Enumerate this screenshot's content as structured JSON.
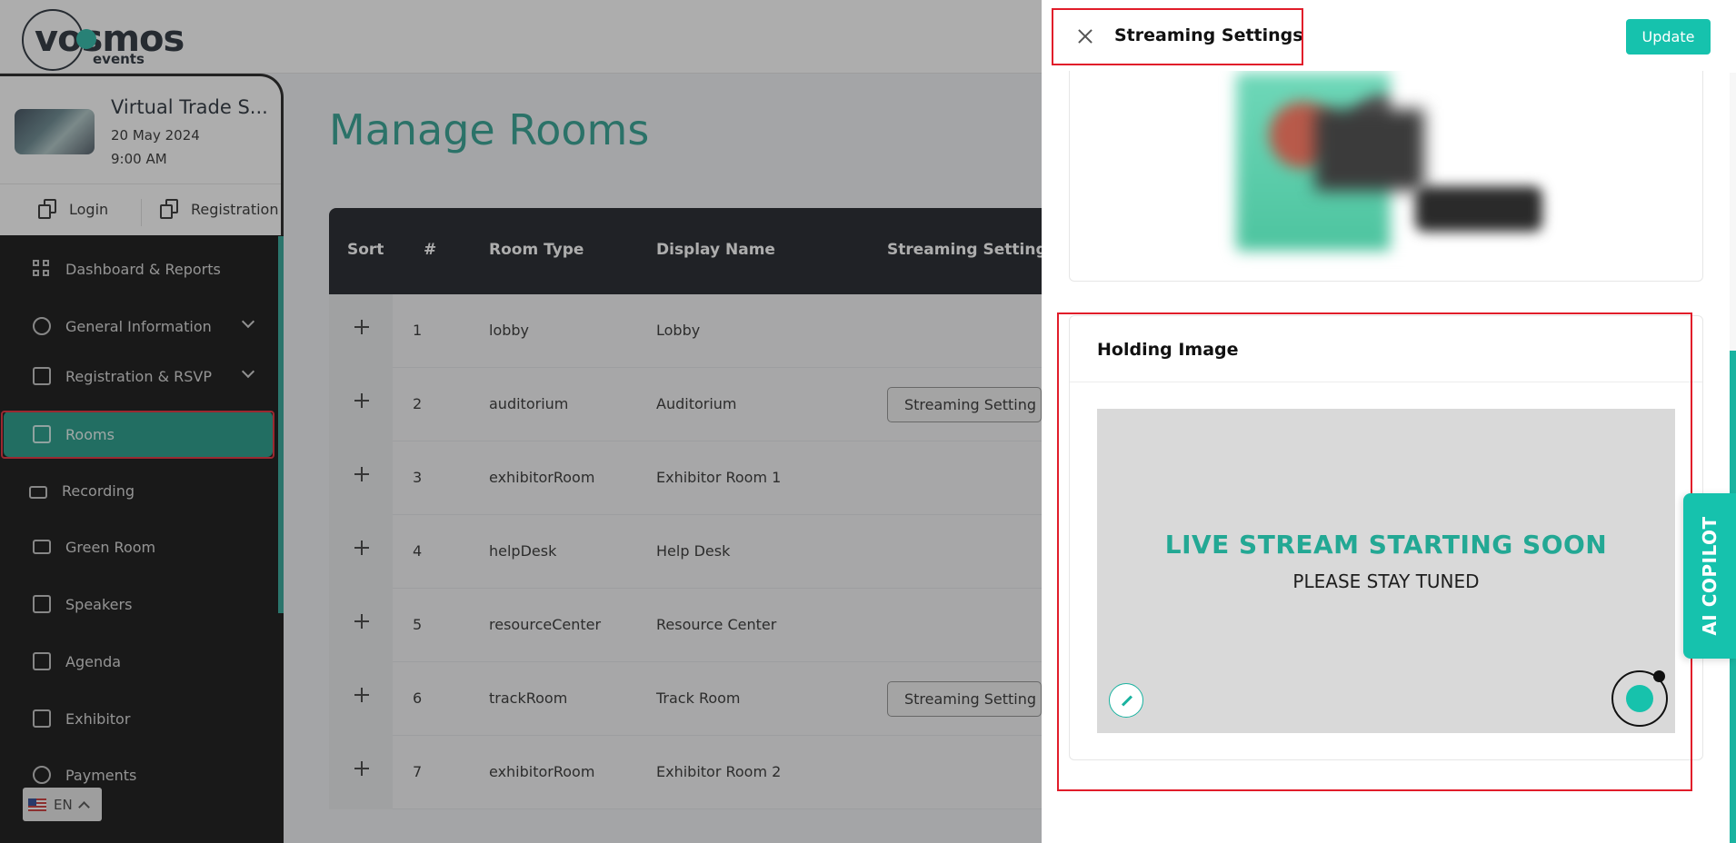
{
  "brand": {
    "logo_text": "vosmos",
    "logo_sub": "events"
  },
  "event": {
    "title": "Virtual Trade S...",
    "date": "20 May 2024",
    "time": "9:00 AM",
    "login_label": "Login",
    "registration_label": "Registration"
  },
  "sidebar": {
    "items": [
      {
        "label": "Dashboard & Reports",
        "icon": "dashboard-icon"
      },
      {
        "label": "General Information",
        "icon": "info-icon",
        "expandable": true
      },
      {
        "label": "Registration & RSVP",
        "icon": "calendar-icon",
        "expandable": true
      },
      {
        "label": "Rooms",
        "icon": "home-icon",
        "active": true
      },
      {
        "label": "Recording",
        "icon": "video-icon"
      },
      {
        "label": "Green Room",
        "icon": "folder-icon"
      },
      {
        "label": "Speakers",
        "icon": "speaker-icon"
      },
      {
        "label": "Agenda",
        "icon": "agenda-icon"
      },
      {
        "label": "Exhibitor",
        "icon": "exhibitor-icon"
      },
      {
        "label": "Payments",
        "icon": "payments-icon"
      }
    ]
  },
  "language": {
    "code": "EN"
  },
  "main": {
    "title": "Manage Rooms",
    "columns": [
      "Sort",
      "#",
      "Room Type",
      "Display Name",
      "Streaming Settings"
    ],
    "rows": [
      {
        "num": "1",
        "type": "lobby",
        "name": "Lobby",
        "stream": ""
      },
      {
        "num": "2",
        "type": "auditorium",
        "name": "Auditorium",
        "stream": "Streaming Setting"
      },
      {
        "num": "3",
        "type": "exhibitorRoom",
        "name": "Exhibitor Room 1",
        "stream": ""
      },
      {
        "num": "4",
        "type": "helpDesk",
        "name": "Help Desk",
        "stream": ""
      },
      {
        "num": "5",
        "type": "resourceCenter",
        "name": "Resource Center",
        "stream": ""
      },
      {
        "num": "6",
        "type": "trackRoom",
        "name": "Track Room",
        "stream": "Streaming Setting"
      },
      {
        "num": "7",
        "type": "exhibitorRoom",
        "name": "Exhibitor Room 2",
        "stream": ""
      }
    ]
  },
  "drawer": {
    "title": "Streaming Settings",
    "update_label": "Update",
    "holding": {
      "title": "Holding Image",
      "headline": "LIVE STREAM STARTING SOON",
      "subline": "PLEASE STAY TUNED"
    },
    "copilot_label": "AI COPILOT"
  },
  "colors": {
    "accent": "#16c2ad",
    "title_teal": "#1f9a88",
    "highlight_red": "#e11d2a"
  }
}
